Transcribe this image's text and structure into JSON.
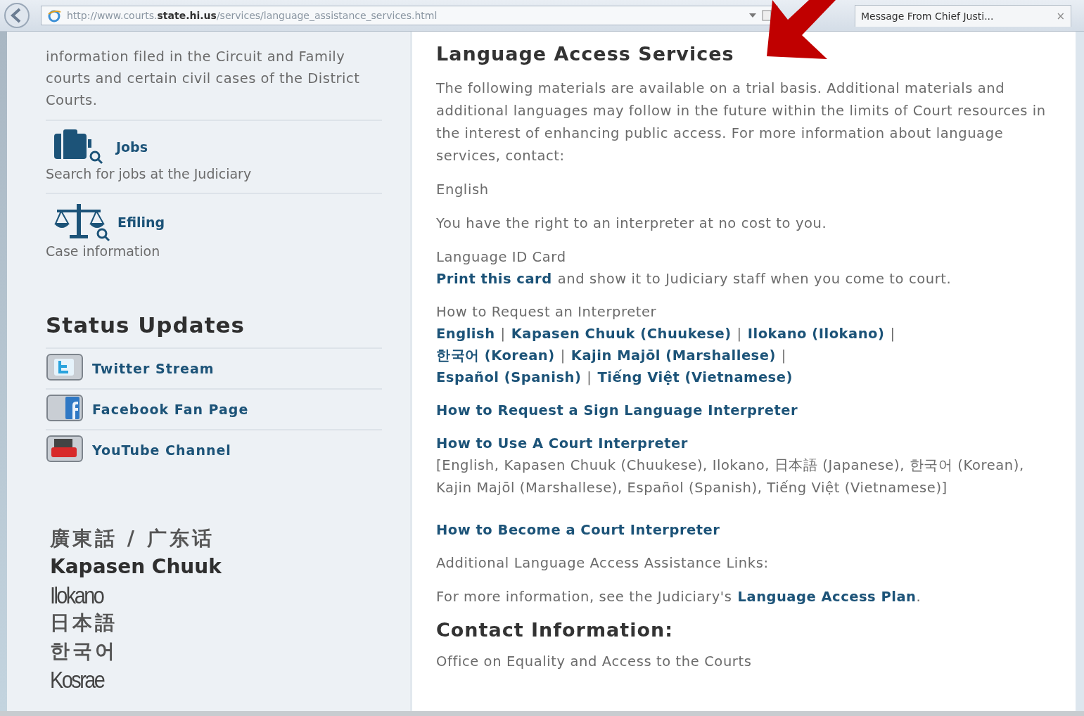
{
  "browser": {
    "url": "http://www.courts.**state.hi.us**/services/language_assistance_services.html",
    "tab": {
      "title": "Message From Chief Justi...",
      "close": "×"
    }
  },
  "sidebar": {
    "intro": "information filed in the Circuit and Family courts and certain civil cases of the District Courts.",
    "features": [
      {
        "kind": "jobs",
        "title": "Jobs",
        "description": "Search for jobs at the Judiciary"
      },
      {
        "kind": "efiling",
        "title": "Efiling",
        "description": "Case information"
      }
    ],
    "status_heading": "Status Updates",
    "social": [
      {
        "kind": "twitter",
        "label": "Twitter Stream"
      },
      {
        "kind": "facebook",
        "label": "Facebook Fan Page"
      },
      {
        "kind": "youtube",
        "label": "YouTube Channel"
      }
    ],
    "languages": [
      {
        "kind": "cjk",
        "text": "廣東話 / 广东话"
      },
      {
        "kind": "bold",
        "text": "Kapasen Chuuk"
      },
      {
        "kind": "condensed",
        "text": "Ilokano"
      },
      {
        "kind": "cjk",
        "text": "日本語"
      },
      {
        "kind": "cjk",
        "text": "한국어"
      },
      {
        "kind": "condensed",
        "text": "Kosrae"
      }
    ]
  },
  "main": {
    "title": "Language Access Services",
    "intro": "The following materials are available on a trial basis. Additional materials and additional languages may follow in the future within the limits of Court resources in the interest of enhancing public access. For more information about language services, contact:",
    "english_label": "English",
    "rights": "You have the right to an interpreter at no cost to you.",
    "id_card": {
      "heading": "Language ID Card",
      "link": "Print this card",
      "rest": "and show it to Judiciary staff when you come to court."
    },
    "request": {
      "heading": "How to Request an Interpreter",
      "lines": [
        [
          {
            "kind": "link",
            "text": "English"
          },
          {
            "kind": "sep",
            "text": "|"
          },
          {
            "kind": "link",
            "text": "Kapasen Chuuk (Chuukese)"
          },
          {
            "kind": "sep",
            "text": "|"
          },
          {
            "kind": "link",
            "text": "Ilokano (Ilokano)"
          },
          {
            "kind": "sep",
            "text": "|"
          }
        ],
        [
          {
            "kind": "link",
            "text": "한국어 (Korean)"
          },
          {
            "kind": "sep",
            "text": "|"
          },
          {
            "kind": "link",
            "text": "Kajin Majōl (Marshallese)"
          },
          {
            "kind": "sep",
            "text": "|"
          }
        ],
        [
          {
            "kind": "link",
            "text": "Español (Spanish)"
          },
          {
            "kind": "sep",
            "text": "|"
          },
          {
            "kind": "link",
            "text": "Tiếng Việt (Vietnamese)"
          }
        ]
      ]
    },
    "sign_link": "How to Request a Sign Language Interpreter",
    "use": {
      "link": "How to Use A Court Interpreter",
      "languages": "[English, Kapasen Chuuk (Chuukese), Ilokano, 日本語 (Japanese), 한국어 (Korean), Kajin Majōl (Marshallese), Español (Spanish), Tiếng Việt (Vietnamese)]"
    },
    "become_link": "How to Become a Court Interpreter",
    "additional": "Additional Language Access Assistance Links:",
    "plan": {
      "text": "For more information, see the Judiciary's",
      "link": "Language Access Plan",
      "after": "."
    },
    "contact_heading": "Contact Information:",
    "office": "Office on Equality and Access to the Courts"
  }
}
